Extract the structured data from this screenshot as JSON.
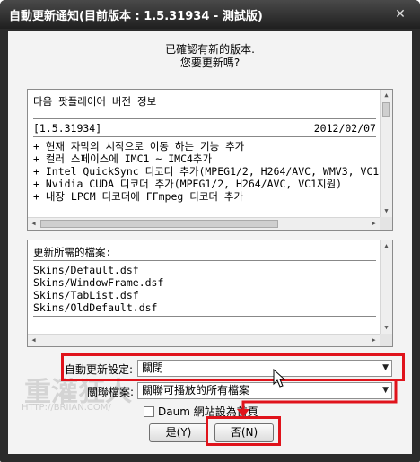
{
  "window": {
    "title": "自動更新通知(目前版本 : 1.5.31934 - 測試版)",
    "close_glyph": "✕"
  },
  "message": {
    "line1": "已確認有新的版本.",
    "line2": "您要更新嗎?"
  },
  "release_notes": {
    "header": "다음 팟플레이어 버전 정보",
    "version": "[1.5.31934]",
    "date": "2012/02/07",
    "items": [
      "+ 현재 자막의 시작으로 이동 하는 기능 추가",
      "+ 컬러 스페이스에 IMC1 ~ IMC4추가",
      "+ Intel QuickSync 디코더 추가(MPEG1/2, H264/AVC, WMV3, VC1지원)",
      "+ Nvidia CUDA 디코더 추가(MPEG1/2, H264/AVC, VC1지원)",
      "+ 내장 LPCM 디코더에 FFmpeg 디코더 추가"
    ]
  },
  "files": {
    "header": "更新所需的檔案:",
    "items": [
      "Skins/Default.dsf",
      "Skins/WindowFrame.dsf",
      "Skins/TabList.dsf",
      "Skins/OldDefault.dsf"
    ]
  },
  "form": {
    "auto_update_label": "自動更新設定:",
    "auto_update_value": "關閉",
    "assoc_label": "關聯檔案:",
    "assoc_value": "關聯可播放的所有檔案",
    "daum_checkbox_label": "Daum 網站設為首頁"
  },
  "buttons": {
    "yes": "是(Y)",
    "no": "否(N)"
  },
  "watermark": {
    "text": "重灌狂人",
    "url": "HTTP://BRIIAN.COM/"
  },
  "colors": {
    "highlight": "#e0131b",
    "titlebar": "#2b2b2b"
  }
}
